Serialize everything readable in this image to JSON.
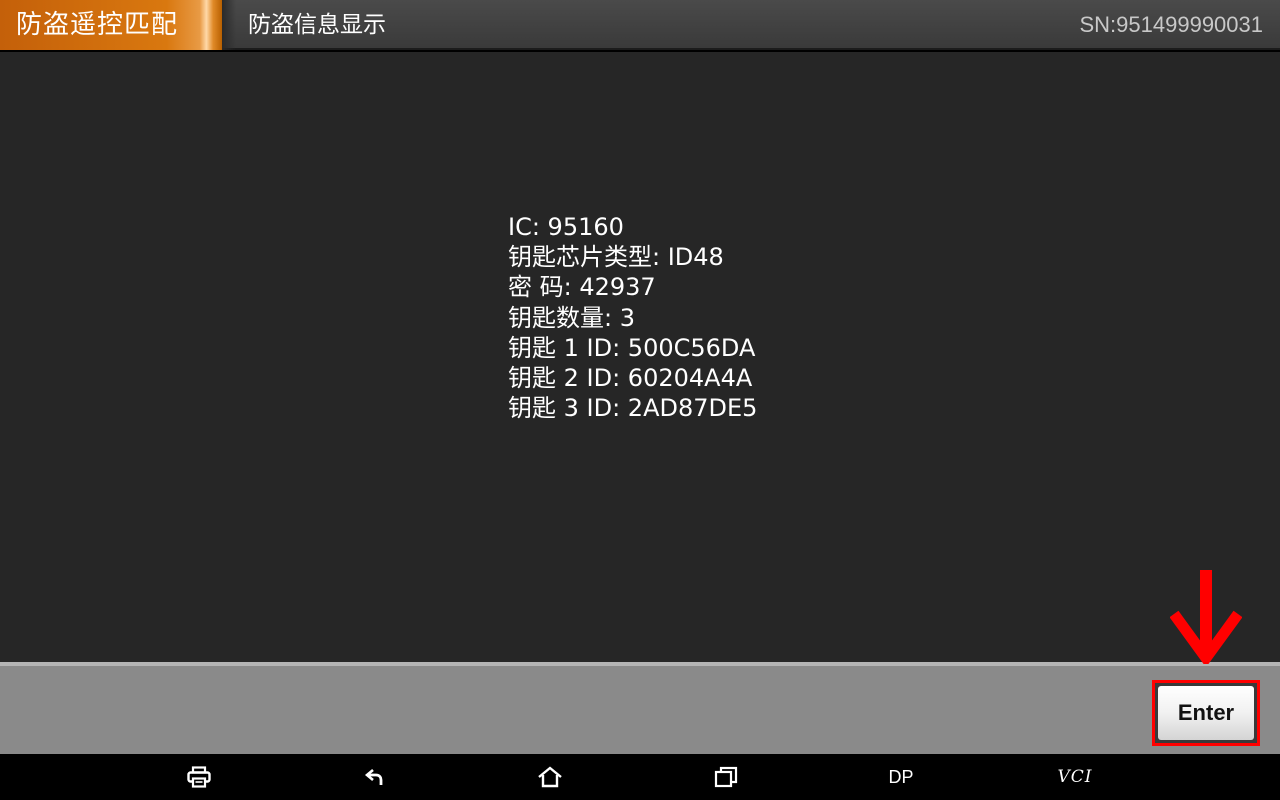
{
  "header": {
    "menu_tab": "防盗遥控匹配",
    "page_title": "防盗信息显示",
    "serial": "SN:951499990031"
  },
  "info": {
    "lines": [
      "IC:  95160",
      "钥匙芯片类型:  ID48",
      "密 码:  42937",
      "钥匙数量:  3",
      "钥匙 1 ID:  500C56DA",
      "钥匙 2 ID:  60204A4A",
      "钥匙 3 ID:  2AD87DE5"
    ]
  },
  "actions": {
    "enter_label": "Enter",
    "highlight_color": "#ff0000"
  },
  "nav": {
    "icons": [
      "print-icon",
      "back-icon",
      "home-icon",
      "recent-apps-icon"
    ],
    "dp_label": "DP",
    "vci_label": "VCI"
  },
  "colors": {
    "accent": "#d9780f",
    "content_bg": "#262626",
    "action_bar_bg": "#8a8a8a"
  }
}
